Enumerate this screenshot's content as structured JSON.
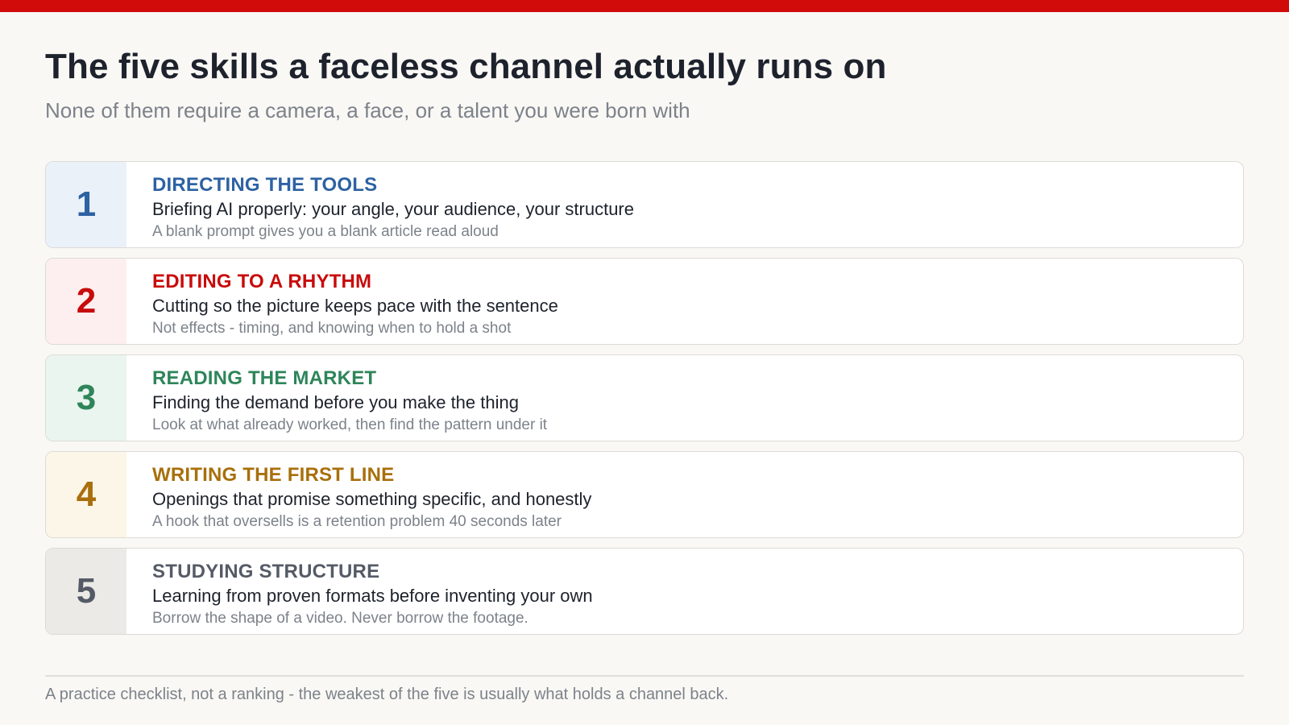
{
  "title": "The five skills a faceless channel actually runs on",
  "subtitle": "None of them require a camera, a face, or a talent you were born with",
  "skills": [
    {
      "number": "1",
      "heading": "DIRECTING THE TOOLS",
      "description": "Briefing AI properly: your angle, your audience, your structure",
      "note": "A blank prompt gives you a blank article read aloud",
      "accent_color": "#2d62a3",
      "tint_color": "#ebf1f9"
    },
    {
      "number": "2",
      "heading": "EDITING TO A RHYTHM",
      "description": "Cutting so the picture keeps pace with the sentence",
      "note": "Not effects - timing, and knowing when to hold a shot",
      "accent_color": "#c80b0b",
      "tint_color": "#fdefef"
    },
    {
      "number": "3",
      "heading": "READING THE MARKET",
      "description": "Finding the demand before you make the thing",
      "note": "Look at what already worked, then find the pattern under it",
      "accent_color": "#2e855a",
      "tint_color": "#ebf5ef"
    },
    {
      "number": "4",
      "heading": "WRITING THE FIRST LINE",
      "description": "Openings that promise something specific, and honestly",
      "note": "A hook that oversells is a retention problem 40 seconds later",
      "accent_color": "#a86f0c",
      "tint_color": "#fcf6e8"
    },
    {
      "number": "5",
      "heading": "STUDYING STRUCTURE",
      "description": "Learning from proven formats before inventing your own",
      "note": "Borrow the shape of a video. Never borrow the footage.",
      "accent_color": "#555b66",
      "tint_color": "#ebeae6"
    }
  ],
  "footnote": "A practice checklist, not a ranking - the weakest of the five is usually what holds a channel back.",
  "colors": {
    "top_bar": "#d10a0a",
    "background": "#f9f8f5",
    "title": "#1d222c",
    "muted": "#7d828a"
  }
}
